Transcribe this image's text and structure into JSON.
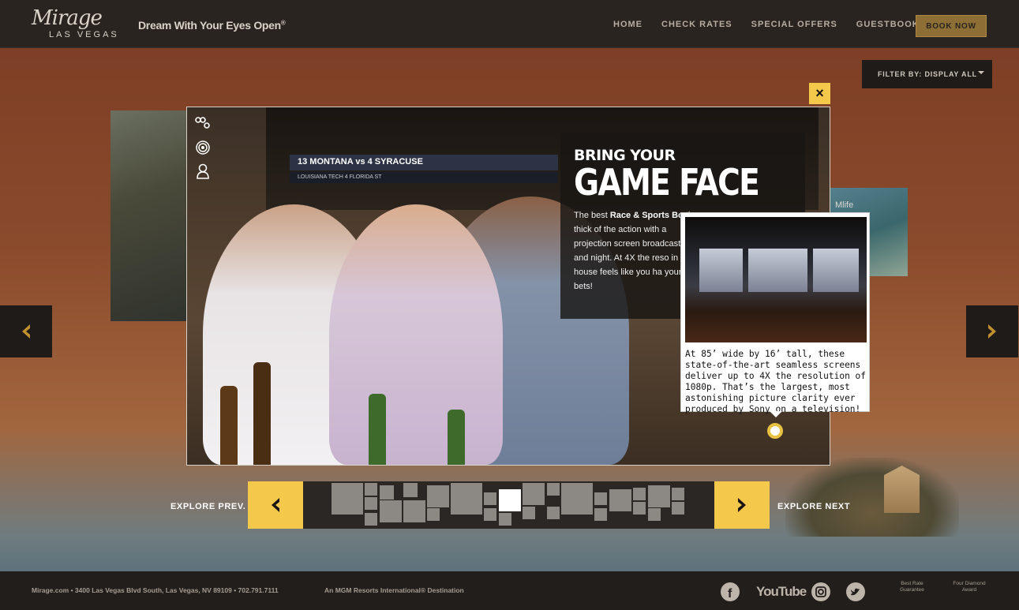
{
  "header": {
    "logo_script": "Mirage",
    "logo_city": "LAS VEGAS",
    "tagline": "Dream With Your Eyes Open",
    "tagline_mark": "®",
    "nav": [
      "HOME",
      "CHECK RATES",
      "SPECIAL OFFERS",
      "GUESTBOOK"
    ],
    "book_label": "BOOK NOW"
  },
  "filter": {
    "label": "FILTER BY: DISPLAY ALL"
  },
  "background": {
    "right_tile_text": "Mlife"
  },
  "modal": {
    "scoreboard": "13 MONTANA  vs  4 SYRACUSE",
    "scoreboard_sub": "LOUISIANA TECH          4 FLORIDA ST",
    "headline_small": "BRING YOUR",
    "headline_large": "GAME FACE",
    "body_prefix": "The best ",
    "body_bold": "Race & Sports Bo",
    "body_rest": "the thick of the action with a projection screen broadcast day and night. At 4X the reso in the house feels like you ha your bets!",
    "close_icon": "×"
  },
  "popup": {
    "text": "At 85’ wide by 16’ tall, these state-of-the-art seamless screens deliver up to 4X the resolution of 1080p. That’s the largest, most astonishing picture clarity ever produced by Sony on a television!"
  },
  "explore": {
    "prev_label": "EXPLORE PREV.",
    "next_label": "EXPLORE NEXT",
    "prev_icon": "‹",
    "next_icon": "›"
  },
  "footer": {
    "address": "Mirage.com • 3400 Las Vegas Blvd South, Las Vegas, NV 89109 • 702.791.7111",
    "mgm": "An MGM Resorts International® Destination",
    "youtube": "YouTube",
    "badge_best_rate": "Best Rate Guarantee",
    "badge_four_diamond": "Four Diamond Award"
  }
}
